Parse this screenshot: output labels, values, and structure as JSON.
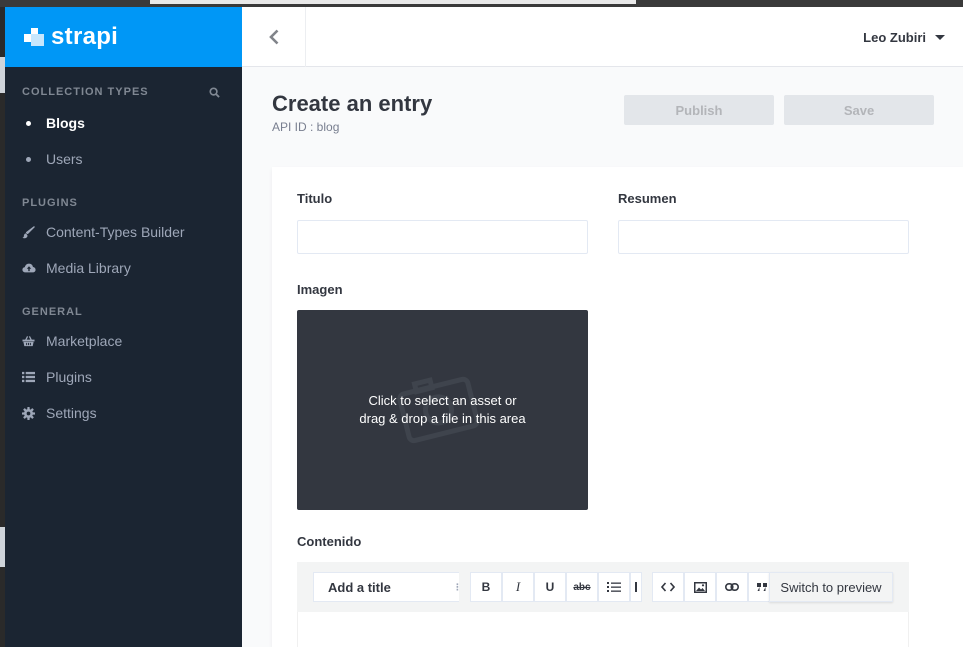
{
  "brand": {
    "name": "strapi",
    "color": "#0097f6"
  },
  "sidebar": {
    "collection_types": {
      "title": "COLLECTION TYPES",
      "items": [
        {
          "label": "Blogs",
          "active": true
        },
        {
          "label": "Users",
          "active": false
        }
      ]
    },
    "plugins": {
      "title": "PLUGINS",
      "items": [
        {
          "label": "Content-Types Builder",
          "icon": "paintbrush-icon"
        },
        {
          "label": "Media Library",
          "icon": "cloud-upload-icon"
        }
      ]
    },
    "general": {
      "title": "GENERAL",
      "items": [
        {
          "label": "Marketplace",
          "icon": "basket-icon"
        },
        {
          "label": "Plugins",
          "icon": "list-icon"
        },
        {
          "label": "Settings",
          "icon": "gear-icon"
        }
      ]
    }
  },
  "topbar": {
    "user_name": "Leo Zubiri"
  },
  "page": {
    "title": "Create an entry",
    "subtitle": "API ID : blog",
    "publish_label": "Publish",
    "save_label": "Save"
  },
  "form": {
    "titulo_label": "Titulo",
    "resumen_label": "Resumen",
    "imagen_label": "Imagen",
    "dropzone_line1": "Click to select an asset or",
    "dropzone_line2": "drag & drop a file in this area",
    "contenido_label": "Contenido"
  },
  "editor": {
    "heading_select": "Add a title",
    "toolbar": {
      "bold": "B",
      "italic": "I",
      "underline": "U",
      "strike": "abc"
    },
    "switch_label": "Switch to preview"
  }
}
